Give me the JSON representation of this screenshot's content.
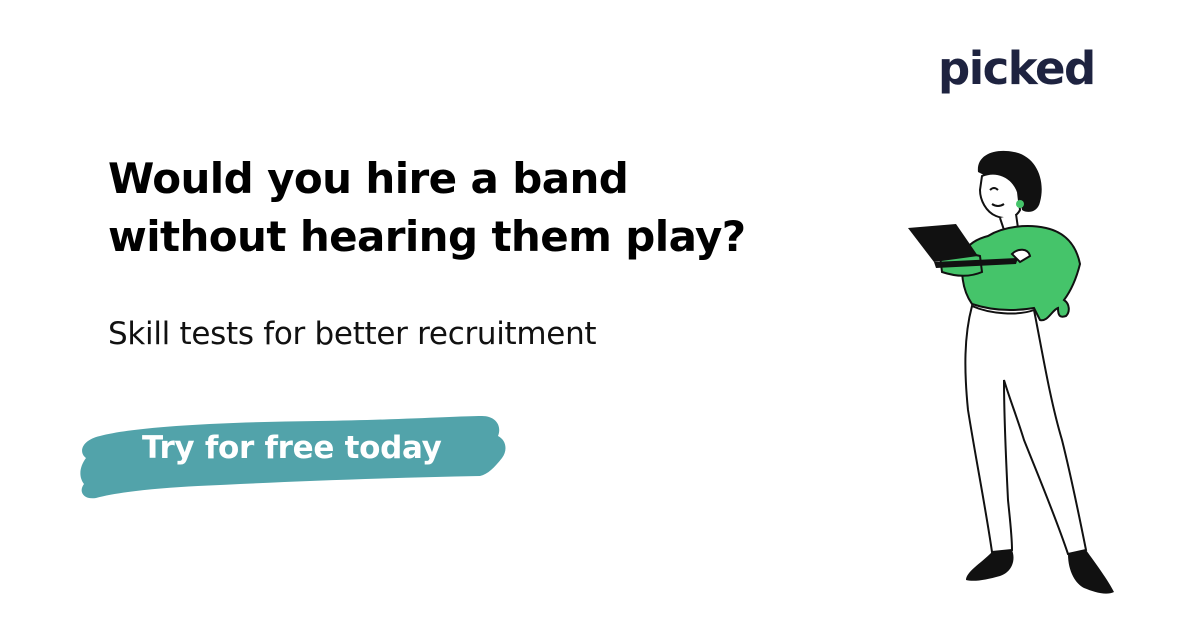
{
  "brand": {
    "logo_text": "picked",
    "logo_color": "#1e2340"
  },
  "hero": {
    "headline_line1": "Would you hire a band",
    "headline_line2": "without hearing them play?",
    "subheadline": "Skill tests for better recruitment"
  },
  "cta": {
    "label": "Try for free today",
    "color": "#52a3aa"
  },
  "illustration": {
    "subject": "woman-with-laptop",
    "accent_color": "#45c46a"
  }
}
